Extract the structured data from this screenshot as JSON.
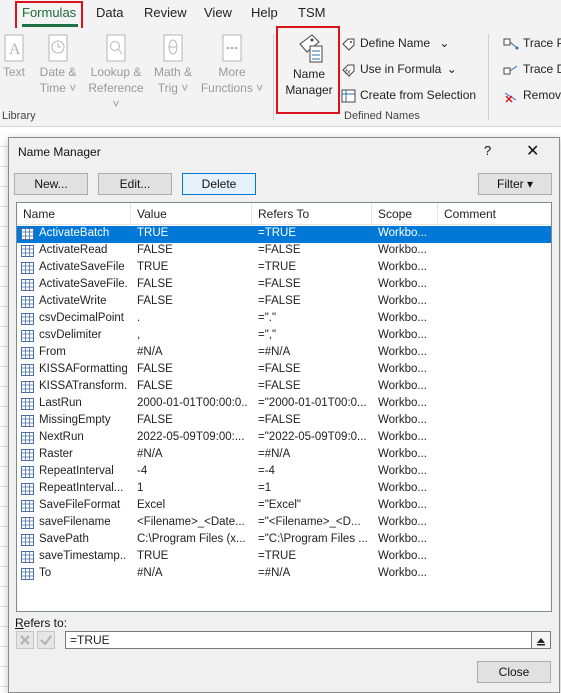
{
  "ribbon": {
    "tabs": [
      "Formulas",
      "Data",
      "Review",
      "View",
      "Help",
      "TSM"
    ],
    "function_library": {
      "buttons": [
        {
          "label1": "Text",
          "label2": "",
          "icon": "text-icon"
        },
        {
          "label1": "Date &",
          "label2": "Time ˅",
          "icon": "date-time-icon"
        },
        {
          "label1": "Lookup &",
          "label2": "Reference ˅",
          "icon": "lookup-reference-icon"
        },
        {
          "label1": "Math &",
          "label2": "Trig ˅",
          "icon": "math-trig-icon"
        },
        {
          "label1": "More",
          "label2": "Functions ˅",
          "icon": "more-functions-icon"
        }
      ],
      "group_label": "Library"
    },
    "defined_names": {
      "name_manager_line1": "Name",
      "name_manager_line2": "Manager",
      "define_name": "Define Name",
      "use_in_formula": "Use in Formula",
      "create_from_selection": "Create from Selection",
      "group_label": "Defined Names"
    },
    "auditing": {
      "trace_precedents": "Trace P",
      "trace_dependents": "Trace D",
      "remove_arrows": "Remov"
    }
  },
  "dialog": {
    "title": "Name Manager",
    "help": "?",
    "close": "✕",
    "buttons": {
      "new": "New...",
      "edit": "Edit...",
      "delete": "Delete",
      "filter": "Filter ▾"
    },
    "columns": [
      "Name",
      "Value",
      "Refers To",
      "Scope",
      "Comment"
    ],
    "rows": [
      {
        "name": "ActivateBatch",
        "value": "TRUE",
        "refers": "=TRUE",
        "scope": "Workbo...",
        "selected": true
      },
      {
        "name": "ActivateRead",
        "value": "FALSE",
        "refers": "=FALSE",
        "scope": "Workbo..."
      },
      {
        "name": "ActivateSaveFile",
        "value": "TRUE",
        "refers": "=TRUE",
        "scope": "Workbo..."
      },
      {
        "name": "ActivateSaveFile...",
        "value": "FALSE",
        "refers": "=FALSE",
        "scope": "Workbo..."
      },
      {
        "name": "ActivateWrite",
        "value": "FALSE",
        "refers": "=FALSE",
        "scope": "Workbo..."
      },
      {
        "name": "csvDecimalPoint",
        "value": ".",
        "refers": "=\".\"",
        "scope": "Workbo..."
      },
      {
        "name": "csvDelimiter",
        "value": ",",
        "refers": "=\",\"",
        "scope": "Workbo..."
      },
      {
        "name": "From",
        "value": "#N/A",
        "refers": "=#N/A",
        "scope": "Workbo..."
      },
      {
        "name": "KISSAFormatting",
        "value": "FALSE",
        "refers": "=FALSE",
        "scope": "Workbo..."
      },
      {
        "name": "KISSATransform...",
        "value": "FALSE",
        "refers": "=FALSE",
        "scope": "Workbo..."
      },
      {
        "name": "LastRun",
        "value": "2000-01-01T00:00:0...",
        "refers": "=\"2000-01-01T00:0...",
        "scope": "Workbo..."
      },
      {
        "name": "MissingEmpty",
        "value": "FALSE",
        "refers": "=FALSE",
        "scope": "Workbo..."
      },
      {
        "name": "NextRun",
        "value": "2022-05-09T09:00:...",
        "refers": "=\"2022-05-09T09:0...",
        "scope": "Workbo..."
      },
      {
        "name": "Raster",
        "value": "#N/A",
        "refers": "=#N/A",
        "scope": "Workbo..."
      },
      {
        "name": "RepeatInterval",
        "value": "-4",
        "refers": "=-4",
        "scope": "Workbo..."
      },
      {
        "name": "RepeatInterval...",
        "value": "1",
        "refers": "=1",
        "scope": "Workbo..."
      },
      {
        "name": "SaveFileFormat",
        "value": "Excel",
        "refers": "=\"Excel\"",
        "scope": "Workbo..."
      },
      {
        "name": "saveFilename",
        "value": "<Filename>_<Date...",
        "refers": "=\"<Filename>_<D...",
        "scope": "Workbo..."
      },
      {
        "name": "SavePath",
        "value": "C:\\Program Files (x...",
        "refers": "=\"C:\\Program Files ...",
        "scope": "Workbo..."
      },
      {
        "name": "saveTimestamp...",
        "value": "TRUE",
        "refers": "=TRUE",
        "scope": "Workbo..."
      },
      {
        "name": "To",
        "value": "#N/A",
        "refers": "=#N/A",
        "scope": "Workbo..."
      }
    ],
    "refers_to_label_first": "R",
    "refers_to_label_rest": "efers to:",
    "refers_to_value": "=TRUE",
    "close_button": "Close"
  },
  "colors": {
    "selection": "#0078d7",
    "highlight": "#d9121b",
    "active_tab": "#1e7145"
  }
}
